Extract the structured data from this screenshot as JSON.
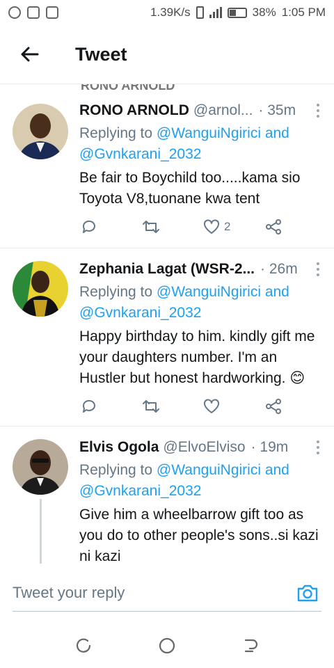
{
  "status": {
    "speed": "1.39K/s",
    "battery": "38%",
    "time": "1:05 PM"
  },
  "header": {
    "title": "Tweet"
  },
  "partial_name": "RONO ARNOLD",
  "tweets": [
    {
      "name": "RONO ARNOLD",
      "handle": "@arnol...",
      "time": "· 35m",
      "replying_prefix": "Replying to",
      "replying_line1": "@WanguiNgirici and",
      "replying_line2": "@Gvnkarani_2032",
      "text": "Be fair to Boychild too.....kama sio Toyota V8,tuonane kwa tent",
      "likes": "2"
    },
    {
      "name": "Zephania Lagat (WSR-2...",
      "handle": "",
      "time": "· 26m",
      "replying_prefix": "Replying to",
      "replying_line1": "@WanguiNgirici and",
      "replying_line2": "@Gvnkarani_2032",
      "text": "Happy birthday to him.  kindly gift me your daughters number. I'm an Hustler but honest hardworking. 😊",
      "likes": ""
    },
    {
      "name": "Elvis Ogola",
      "handle": "@ElvoElviso",
      "time": "· 19m",
      "replying_prefix": "Replying to",
      "replying_line1": "@WanguiNgirici and",
      "replying_line2": "@Gvnkarani_2032",
      "text": "Give him a wheelbarrow gift too as you do to other people's sons..si kazi ni kazi",
      "likes": ""
    }
  ],
  "compose": {
    "placeholder": "Tweet your reply"
  },
  "colors": {
    "accent": "#1da1f2",
    "secondary_text": "#657786",
    "primary_text": "#14171a"
  }
}
